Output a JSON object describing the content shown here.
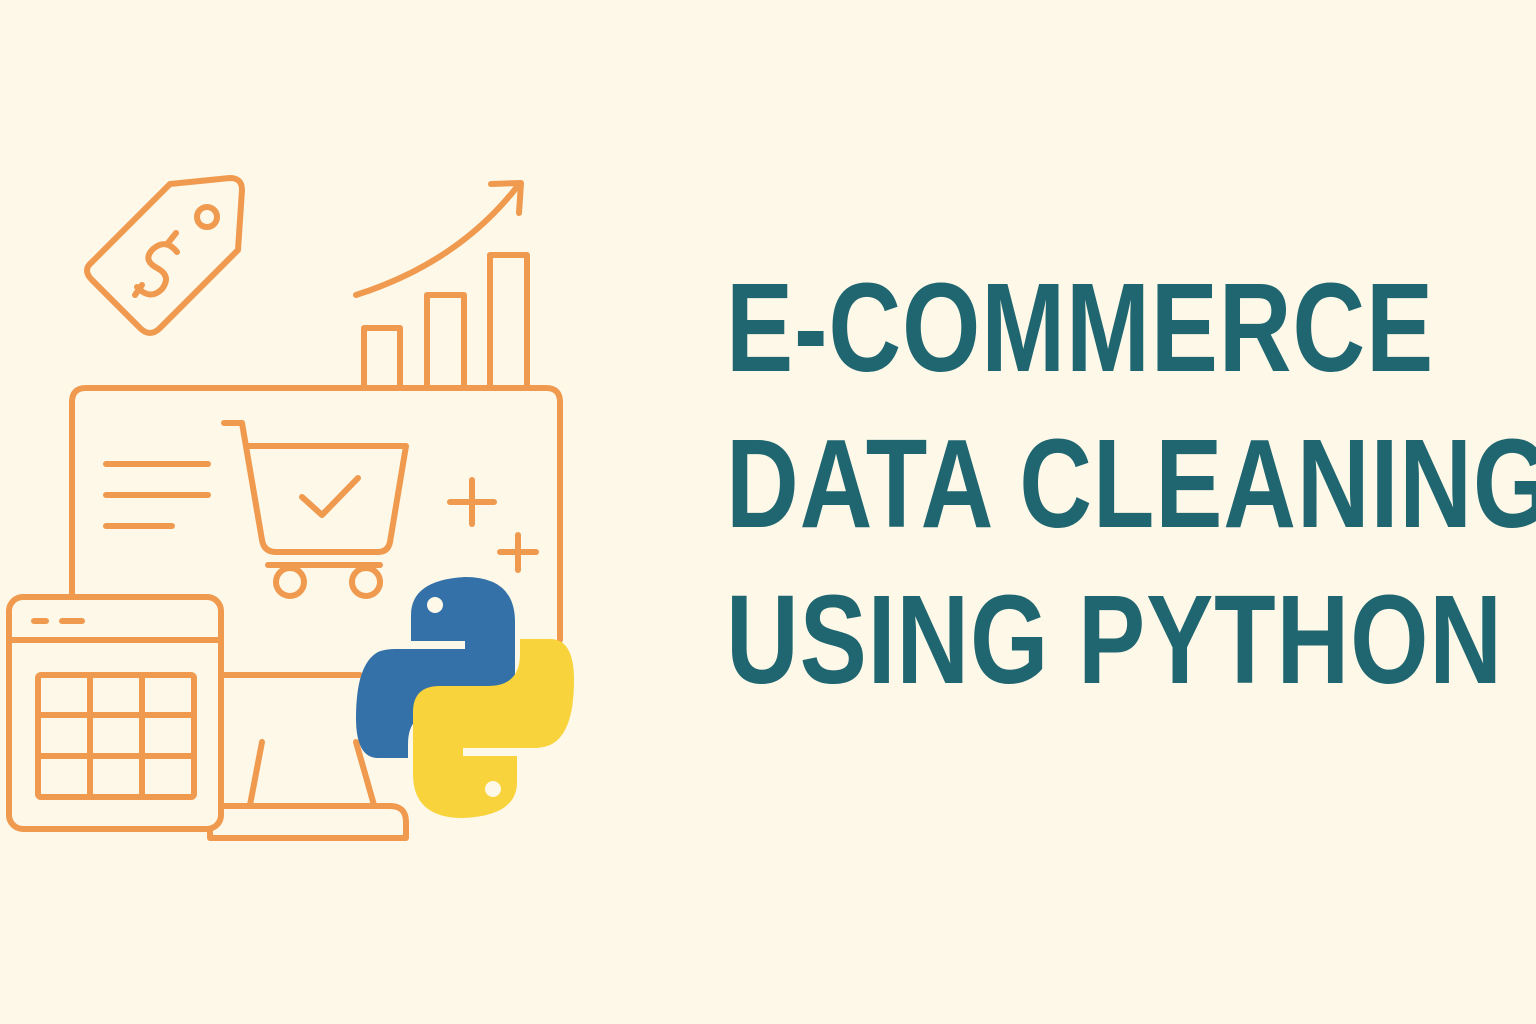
{
  "title": {
    "lines": [
      "E-COMMERCE",
      "DATA CLEANING",
      "USING PYTHON"
    ]
  },
  "illustration": {
    "icons": [
      "price-tag-icon",
      "dollar-sign-icon",
      "growth-chart-icon",
      "trend-arrow-icon",
      "monitor-icon",
      "shopping-cart-icon",
      "checkmark-icon",
      "sparkle-icon",
      "spreadsheet-window-icon",
      "python-logo-icon"
    ],
    "colors": {
      "background": "#fdf8e8",
      "line_art": "#ef9a4f",
      "title_text": "#1f6670",
      "python_blue": "#3471a8",
      "python_yellow": "#f9d33b"
    }
  }
}
